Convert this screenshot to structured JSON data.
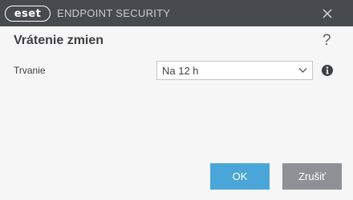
{
  "window": {
    "logo_text": "eset",
    "product_name": "ENDPOINT SECURITY",
    "close_icon": "close-icon"
  },
  "dialog": {
    "title": "Vrátenie zmien",
    "help_label": "?"
  },
  "form": {
    "duration_label": "Trvanie",
    "duration_value": "Na 12 h"
  },
  "buttons": {
    "ok_label": "OK",
    "cancel_label": "Zrušiť"
  },
  "colors": {
    "titlebar": "#474b50",
    "primary_button": "#4aa6d8",
    "secondary_button": "#8e9296"
  }
}
